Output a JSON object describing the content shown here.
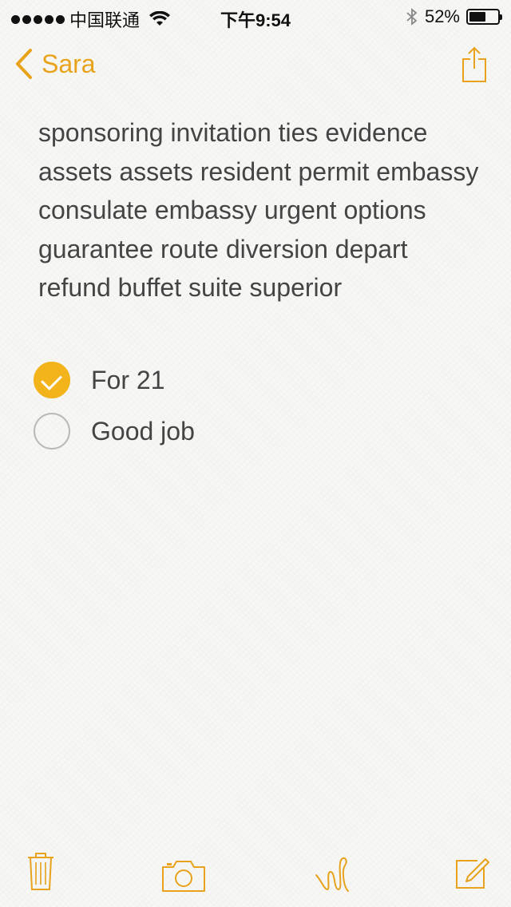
{
  "status": {
    "carrier": "中国联通",
    "time": "下午9:54",
    "battery": "52%",
    "battery_level": 0.52
  },
  "nav": {
    "back_label": "Sara"
  },
  "note": {
    "text": "sponsoring invitation ties evidence assets assets resident permit embassy consulate embassy urgent options guarantee route diversion depart refund buffet suite superior",
    "checklist": [
      {
        "label": "For 21",
        "checked": true
      },
      {
        "label": "Good job",
        "checked": false
      }
    ]
  },
  "colors": {
    "accent": "#e8a21b",
    "checked": "#f2b31b",
    "paper": "#f7f7f5",
    "text": "#444444"
  },
  "icons": {
    "signal": "signal-dots-icon",
    "wifi": "wifi-icon",
    "bluetooth": "bluetooth-icon",
    "battery": "battery-icon",
    "back": "chevron-left-icon",
    "share": "share-icon",
    "trash": "trash-icon",
    "camera": "camera-icon",
    "sketch": "sketch-icon",
    "compose": "compose-icon"
  }
}
